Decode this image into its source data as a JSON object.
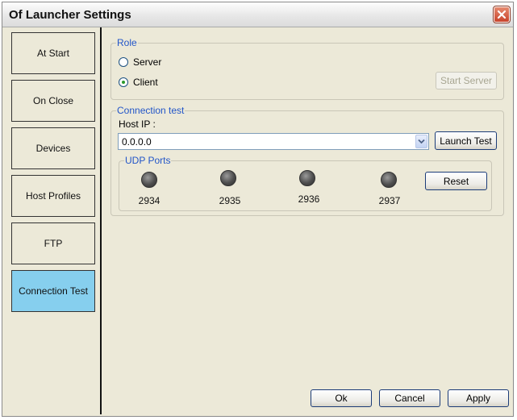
{
  "window": {
    "title": "Of Launcher Settings"
  },
  "sidebar": {
    "items": [
      {
        "label": "At Start",
        "active": false
      },
      {
        "label": "On Close",
        "active": false
      },
      {
        "label": "Devices",
        "active": false
      },
      {
        "label": "Host Profiles",
        "active": false
      },
      {
        "label": "FTP",
        "active": false
      },
      {
        "label": "Connection Test",
        "active": true
      }
    ]
  },
  "role": {
    "legend": "Role",
    "options": [
      {
        "label": "Server",
        "checked": false
      },
      {
        "label": "Client",
        "checked": true
      }
    ],
    "start_server_label": "Start Server"
  },
  "connection_test": {
    "legend": "Connection test",
    "host_ip_label": "Host IP :",
    "host_ip_value": "0.0.0.0",
    "launch_test_label": "Launch Test",
    "udp": {
      "legend": "UDP Ports",
      "ports": [
        "2934",
        "2935",
        "2936",
        "2937"
      ],
      "reset_label": "Reset"
    }
  },
  "footer": {
    "ok_label": "Ok",
    "cancel_label": "Cancel",
    "apply_label": "Apply"
  },
  "colors": {
    "active_tab": "#86cfee",
    "group_legend": "#2255c8",
    "close_button": "#c8432b"
  },
  "icons": {
    "close": "close-icon",
    "dropdown": "chevron-down-icon",
    "port_status": "status-led-icon"
  }
}
